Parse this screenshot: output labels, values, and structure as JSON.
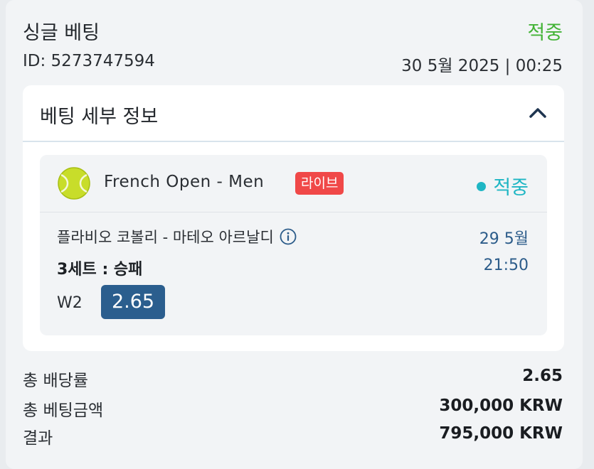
{
  "header": {
    "title": "싱글 베팅",
    "status": "적중",
    "bet_id": "ID: 5273747594",
    "datetime": "30 5월 2025 | 00:25"
  },
  "details": {
    "title": "베팅 세부 정보",
    "toggle_icon": "chevron-up-icon"
  },
  "event": {
    "sport_icon": "tennis-ball-icon",
    "name": "French Open - Men",
    "badge": "라이브",
    "status": "적중",
    "match": "플라비오 코볼리 - 마테오 아르날디",
    "date": "29 5월",
    "time": "21:50",
    "market": "3세트 : 승패",
    "selection": "W2",
    "odds": "2.65"
  },
  "summary": {
    "total_odds_label": "총 배당률",
    "total_odds_value": "2.65",
    "total_stake_label": "총 베팅금액",
    "total_stake_value": "300,000 KRW",
    "result_label": "결과",
    "result_value": "795,000 KRW"
  },
  "colors": {
    "win_green": "#43b336",
    "win_cyan": "#1fb6c4",
    "odds_blue": "#2b5e8e",
    "live_red": "#f04848"
  }
}
